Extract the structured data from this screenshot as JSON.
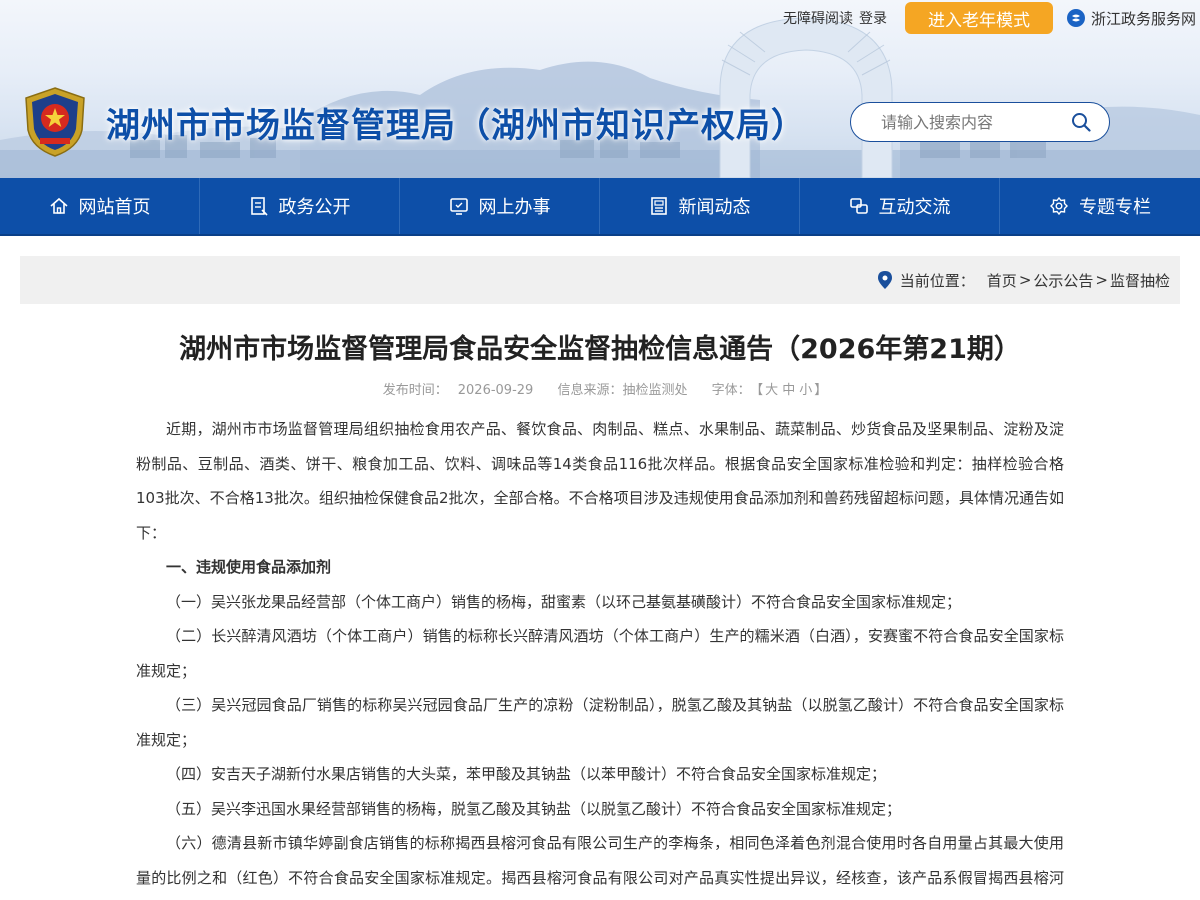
{
  "topbar": {
    "accessibility": "无障碍阅读",
    "login": "登录",
    "elder_mode": "进入老年模式",
    "zj_service": "浙江政务服务网"
  },
  "header": {
    "title": "湖州市市场监督管理局（湖州市知识产权局）",
    "search_placeholder": "请输入搜索内容"
  },
  "nav": {
    "items": [
      {
        "label": "网站首页",
        "icon": "home-icon"
      },
      {
        "label": "政务公开",
        "icon": "doc-icon"
      },
      {
        "label": "网上办事",
        "icon": "screen-icon"
      },
      {
        "label": "新闻动态",
        "icon": "news-icon"
      },
      {
        "label": "互动交流",
        "icon": "chat-icon"
      },
      {
        "label": "专题专栏",
        "icon": "gear-icon"
      }
    ]
  },
  "breadcrumb": {
    "label": "当前位置：",
    "items": [
      "首页",
      "公示公告",
      "监督抽检"
    ],
    "separator": ">"
  },
  "article": {
    "title": "湖州市市场监督管理局食品安全监督抽检信息通告（2026年第21期）",
    "publish_label": "发布时间：",
    "publish_date": "2026-09-29",
    "source_label": "信息来源：",
    "source": "抽检监测处",
    "font_label": "字体：",
    "font_open": "【",
    "font_large": "大",
    "font_medium": "中",
    "font_small": "小",
    "font_close": "】",
    "intro": "近期，湖州市市场监督管理局组织抽检食用农产品、餐饮食品、肉制品、糕点、水果制品、蔬菜制品、炒货食品及坚果制品、淀粉及淀粉制品、豆制品、酒类、饼干、粮食加工品、饮料、调味品等14类食品116批次样品。根据食品安全国家标准检验和判定：抽样检验合格103批次、不合格13批次。组织抽检保健食品2批次，全部合格。不合格项目涉及违规使用食品添加剂和兽药残留超标问题，具体情况通告如下：",
    "section1": "一、违规使用食品添加剂",
    "items": [
      "（一）吴兴张龙果品经营部（个体工商户）销售的杨梅，甜蜜素（以环己基氨基磺酸计）不符合食品安全国家标准规定；",
      "（二）长兴醉清风酒坊（个体工商户）销售的标称长兴醉清风酒坊（个体工商户）生产的糯米酒（白酒），安赛蜜不符合食品安全国家标准规定；",
      "（三）吴兴冠园食品厂销售的标称吴兴冠园食品厂生产的凉粉（淀粉制品），脱氢乙酸及其钠盐（以脱氢乙酸计）不符合食品安全国家标准规定；",
      "（四）安吉天子湖新付水果店销售的大头菜，苯甲酸及其钠盐（以苯甲酸计）不符合食品安全国家标准规定；",
      "（五）吴兴李迅国水果经营部销售的杨梅，脱氢乙酸及其钠盐（以脱氢乙酸计）不符合食品安全国家标准规定；",
      "（六）德清县新市镇华婷副食店销售的标称揭西县榕河食品有限公司生产的李梅条，相同色泽着色剂混合使用时各自用量占其最大使用量的比例之和（红色）不符合食品安全国家标准规定。揭西县榕河食品有限公司对产品真实性提出异议，经核查，该产品系假冒揭西县榕河食品有限公司产品。"
    ]
  },
  "colors": {
    "nav_bg": "#0d4fa8",
    "title_blue": "#0d4fa8",
    "elder_btn": "#f5a623"
  }
}
